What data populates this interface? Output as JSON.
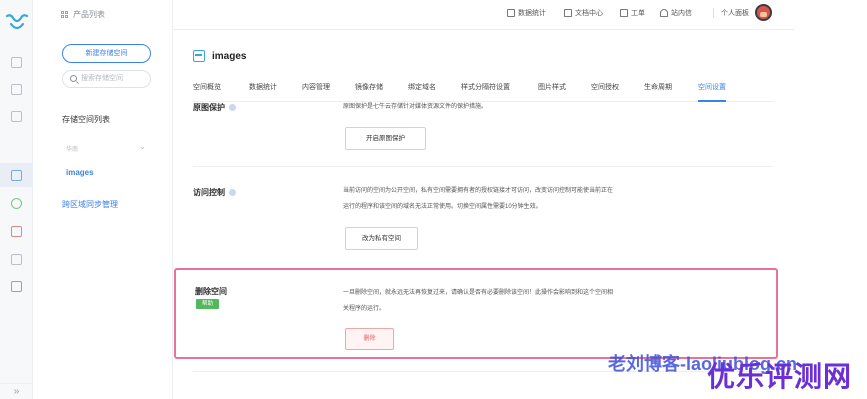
{
  "sidebar": {
    "product_list": "产品列表",
    "new_button": "新建存储空间",
    "search_placeholder": "搜索存储空间",
    "bucket_list_title": "存储空间列表",
    "group_label": "华南",
    "active_bucket": "images",
    "cross_region_link": "跨区域同步管理"
  },
  "topbar": {
    "items": [
      "数据统计",
      "文档中心",
      "工单",
      "站内信"
    ],
    "dashboard": "个人面板"
  },
  "bucket": {
    "name": "images"
  },
  "tabs": [
    "空间概览",
    "数据统计",
    "内容管理",
    "镜像存储",
    "绑定域名",
    "样式分隔符设置",
    "图片样式",
    "空间授权",
    "生命周期",
    "空间设置"
  ],
  "active_tab": "空间设置",
  "sections": {
    "origin_protect": {
      "label": "原图保护",
      "desc": "原图保护是七牛云存储针对媒体资源文件的保护措施。",
      "button": "开启原图保护"
    },
    "access_control": {
      "label": "访问控制",
      "desc_line1": "当前访问的空间为公开空间，私有空间需要拥有者的授权链接才可访问，改变访问控制可能使当前正在",
      "desc_line2": "运行的程序和该空间的域名无法正常使用。切换空间属性需要10分钟生效。",
      "button": "改为私有空间"
    },
    "delete_space": {
      "label": "删除空间",
      "badge": "帮助",
      "desc_line1": "一旦删除空间，就永远无法再恢复过来，请确认是否有必要删除该空间！此操作会影响到和这个空间相",
      "desc_line2": "关程序的运行。",
      "button": "删除"
    }
  },
  "watermark": {
    "blog": "老刘博客-laoliublog.cn",
    "site": "优乐评测网"
  },
  "colors": {
    "accent": "#3b82e8",
    "highlight_border": "#e8739a",
    "danger": "#e85a5a",
    "help_badge": "#52b85c"
  }
}
